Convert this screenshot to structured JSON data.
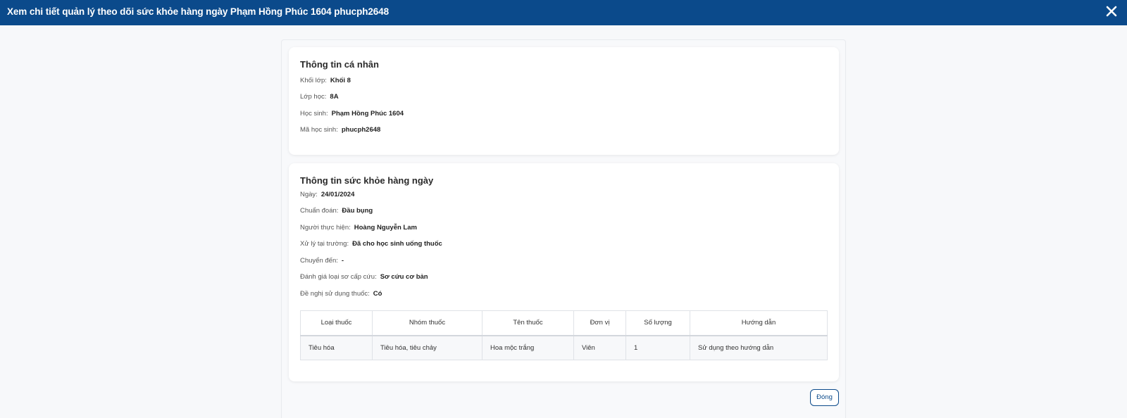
{
  "modal": {
    "title": "Xem chi tiết quản lý theo dõi sức khỏe hàng ngày Phạm Hồng Phúc 1604 phucph2648"
  },
  "personal": {
    "heading": "Thông tin cá nhân",
    "fields": [
      {
        "label": "Khối lớp:",
        "value": "Khối 8"
      },
      {
        "label": "Lớp học:",
        "value": "8A"
      },
      {
        "label": "Học sinh:",
        "value": "Phạm Hồng Phúc 1604"
      },
      {
        "label": "Mã học sinh:",
        "value": "phucph2648"
      }
    ]
  },
  "health": {
    "heading": "Thông tin sức khỏe hàng ngày",
    "fields": [
      {
        "label": "Ngày:",
        "value": "24/01/2024"
      },
      {
        "label": "Chuẩn đoán:",
        "value": "Đầu bụng"
      },
      {
        "label": "Người thực hiện:",
        "value": "Hoàng Nguyễn Lam"
      },
      {
        "label": "Xử lý tại trường:",
        "value": "Đã cho học sinh uống thuốc"
      },
      {
        "label": "Chuyển đến:",
        "value": "-"
      },
      {
        "label": "Đánh giá loại sơ cấp cứu:",
        "value": "Sơ cứu cơ bản"
      },
      {
        "label": "Đề nghị sử dụng thuốc:",
        "value": "Có"
      }
    ]
  },
  "medicine_table": {
    "headers": [
      "Loại thuốc",
      "Nhóm thuốc",
      "Tên thuốc",
      "Đơn vị",
      "Số lượng",
      "Hướng dẫn"
    ],
    "rows": [
      [
        "Tiêu hóa",
        "Tiêu hóa, tiêu chảy",
        "Hoa mộc trắng",
        "Viên",
        "1",
        "Sử dụng theo hướng dẫn"
      ]
    ]
  },
  "footer": {
    "close_label": "Đóng"
  },
  "colors": {
    "header_bg": "#0b4a8b",
    "accent": "#0b4a8b"
  },
  "icons": {
    "close": "close-icon"
  }
}
